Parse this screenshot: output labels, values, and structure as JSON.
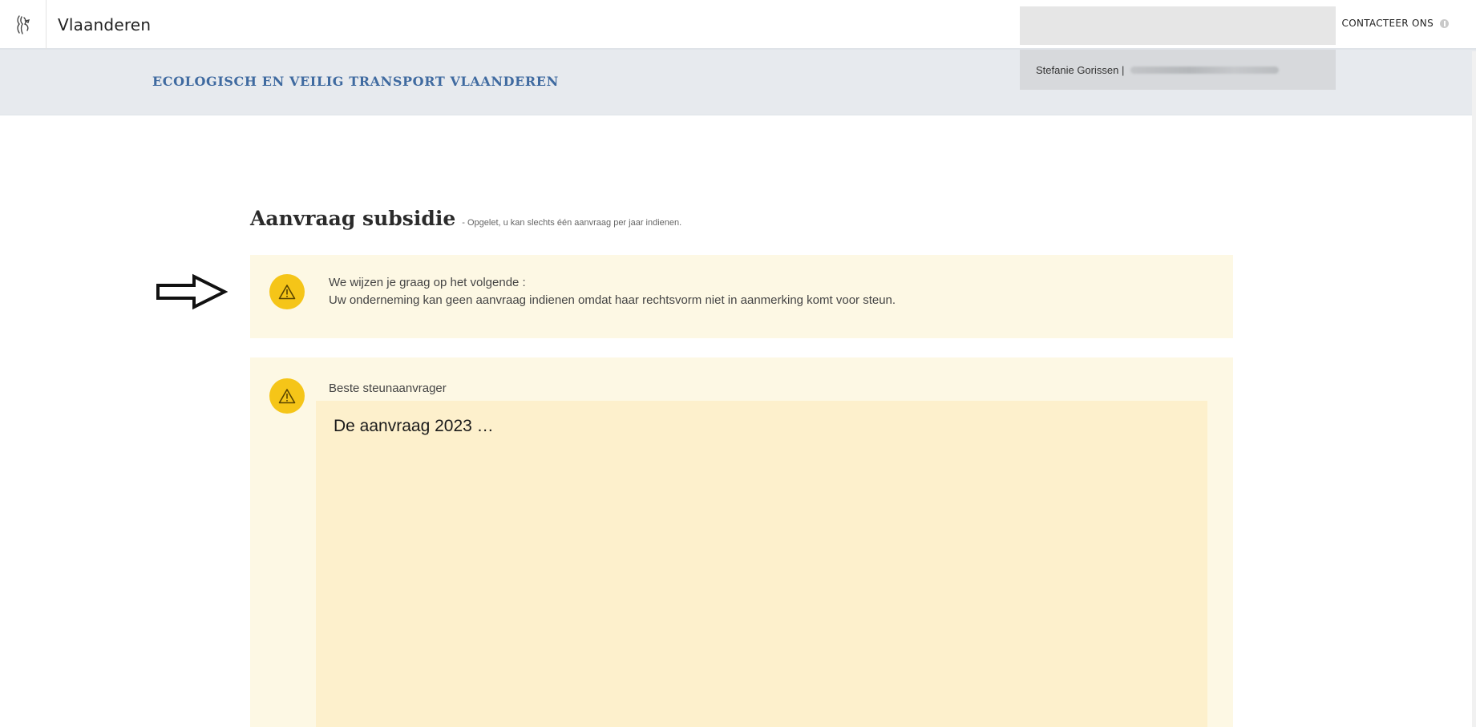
{
  "topbar": {
    "brand": "Vlaanderen",
    "contact_label": "CONTACTEER ONS"
  },
  "header": {
    "site_title": "ECOLOGISCH EN VEILIG TRANSPORT VLAANDEREN",
    "user_name": "Stefanie Gorissen |"
  },
  "main": {
    "heading": "Aanvraag subsidie",
    "heading_note": "- Opgelet, u kan slechts één aanvraag per jaar indienen.",
    "notice": {
      "title": "We wijzen je graag op het volgende :",
      "body": "Uw onderneming kan geen aanvraag indienen omdat haar rechtsvorm niet in aanmerking komt voor steun."
    },
    "message": {
      "greeting": "Beste steunaanvrager",
      "content": "De aanvraag 2023 …"
    }
  },
  "colors": {
    "accent_blue": "#3f6aa0",
    "warning_yellow": "#f5c518",
    "alert_bg": "#fdf8e4",
    "message_bg": "#fdf0cc"
  },
  "icons": [
    "flemish-lion-icon",
    "info-icon",
    "warning-icon",
    "right-arrow-icon"
  ]
}
